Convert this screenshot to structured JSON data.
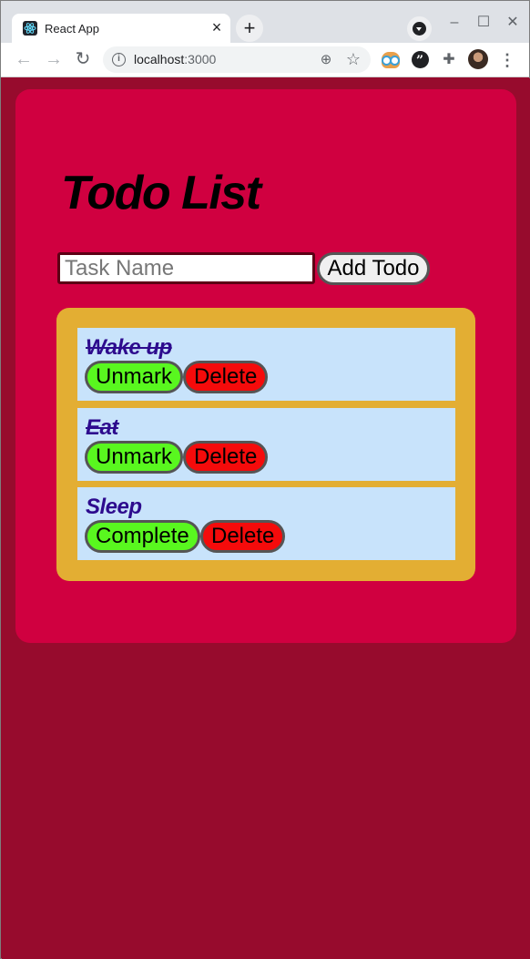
{
  "browser": {
    "tab_title": "React App",
    "tab_close": "×",
    "new_tab": "+",
    "url_host": "localhost",
    "url_port": ":3000",
    "icons": [
      "react-favicon",
      "info-icon",
      "zoom-icon",
      "star-icon",
      "owl-extension-icon",
      "quote-extension-icon",
      "puzzle-icon",
      "avatar",
      "menu-icon"
    ]
  },
  "app": {
    "title": "Todo List",
    "input_placeholder": "Task Name",
    "input_value": "",
    "add_button": "Add Todo"
  },
  "todos": [
    {
      "name": "Wake up",
      "completed": true,
      "toggle_label": "Unmark",
      "delete_label": "Delete"
    },
    {
      "name": "Eat",
      "completed": true,
      "toggle_label": "Unmark",
      "delete_label": "Delete"
    },
    {
      "name": "Sleep",
      "completed": false,
      "toggle_label": "Complete",
      "delete_label": "Delete"
    }
  ],
  "colors": {
    "page_bg": "#970b2d",
    "app_bg": "#d00040",
    "list_bg": "#e3ae33",
    "item_bg": "#c8e3fb",
    "item_text": "#2d0b8e",
    "toggle_bg": "#59f71f",
    "delete_bg": "#f50b0b"
  }
}
